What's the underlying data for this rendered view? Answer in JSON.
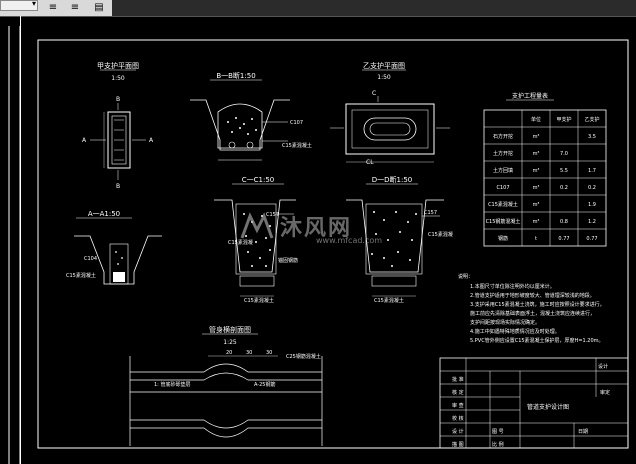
{
  "toolbar": {
    "colors": {
      "bar": "#2b2b2b",
      "group": "#d9d9d9"
    },
    "buttons": [
      {
        "name": "align-left-icon",
        "glyph": "≡"
      },
      {
        "name": "align-right-icon",
        "glyph": "≡"
      },
      {
        "name": "align-justify-icon",
        "glyph": "▤"
      }
    ]
  },
  "drawing": {
    "views": {
      "plan_a": {
        "title": "甲支护平面图",
        "scale": "1:50",
        "mark_b_top": "B",
        "mark_b_bottom": "B",
        "mark_a_left": "A",
        "mark_a_right": "A"
      },
      "section_b": {
        "title": "B一B断1:50",
        "label_c107": "C107",
        "label_c15": "C15素混凝土"
      },
      "plan_b": {
        "title": "乙支护平面图",
        "scale": "1:50",
        "mark_c_top": "C",
        "mark_c_bottom": "CL"
      },
      "section_a": {
        "title": "A一A1:50",
        "label_c104": "C104",
        "label_c15": "C15素混凝土"
      },
      "section_c": {
        "title": "C一C1:50",
        "label_c157": "C157",
        "label_c15_top": "C15素混凝",
        "label_c15": "C15素混凝土",
        "label_note": "锚固钢筋"
      },
      "section_d": {
        "title": "D一D断1:50",
        "label_c157": "C157",
        "label_c15_right": "C15素混凝",
        "label_c15": "C15素混凝土"
      },
      "longitudinal": {
        "title": "管身横剖面图",
        "scale": "1:25",
        "dim_a": "20",
        "dim_b": "30",
        "dim_c": "30",
        "label_top": "C25钢筋混凝土",
        "label_left": "1: 管底砂砾垫层",
        "label_right": "A-25钢筋"
      }
    },
    "qty_table": {
      "title": "支护工程量表",
      "headers": [
        "",
        "单位",
        "甲支护",
        "乙支护"
      ],
      "rows": [
        [
          "石方开挖",
          "m³",
          "",
          "3.5"
        ],
        [
          "土方开挖",
          "m³",
          "7.0",
          ""
        ],
        [
          "土方回填",
          "m³",
          "5.5",
          "1.7"
        ],
        [
          "C107",
          "m³",
          "0.2",
          "0.2"
        ],
        [
          "C15素混凝土",
          "m³",
          "",
          "1.9"
        ],
        [
          "C15钢筋混凝土",
          "m³",
          "0.8",
          "1.2"
        ],
        [
          "钢筋",
          "t",
          "0.77",
          "0.77"
        ]
      ]
    },
    "notes": {
      "heading": "说明：",
      "lines": [
        "1.本图尺寸单位除注明外均以厘米计。",
        "2.管道支护适用于地形坡度较大、管道埋深较浅的地段。",
        "3.支护采用C15素混凝土浇筑，施工时应按照设计要求进行，",
        "施工前应先清除基础表面浮土，混凝土浇筑应连续进行，",
        "支护间距按现场实际情况确定。",
        "4.施工中如遇特殊地质情况应及时处理。",
        "5.PVC管外侧应设置C15素混凝土保护层，厚度H=1.20m。"
      ]
    },
    "title_block": {
      "row1": [
        "批 准",
        "",
        "",
        "设计",
        "审定"
      ],
      "row2": [
        "核 定",
        "",
        "",
        "",
        "校核"
      ],
      "row3": [
        "审 查",
        "",
        "",
        "",
        ""
      ],
      "row4": [
        "校 核",
        "",
        "",
        "",
        ""
      ],
      "row5": [
        "设 计",
        "",
        "",
        "",
        ""
      ],
      "row6": [
        "制 图",
        "",
        "图 号",
        "",
        "日期"
      ],
      "row7": [
        "描 图",
        "",
        "比 例",
        "",
        ""
      ],
      "drawing_name": "管道支护设计图"
    }
  },
  "watermark": {
    "brand": "沐风网",
    "url": "www.mfcad.com"
  }
}
